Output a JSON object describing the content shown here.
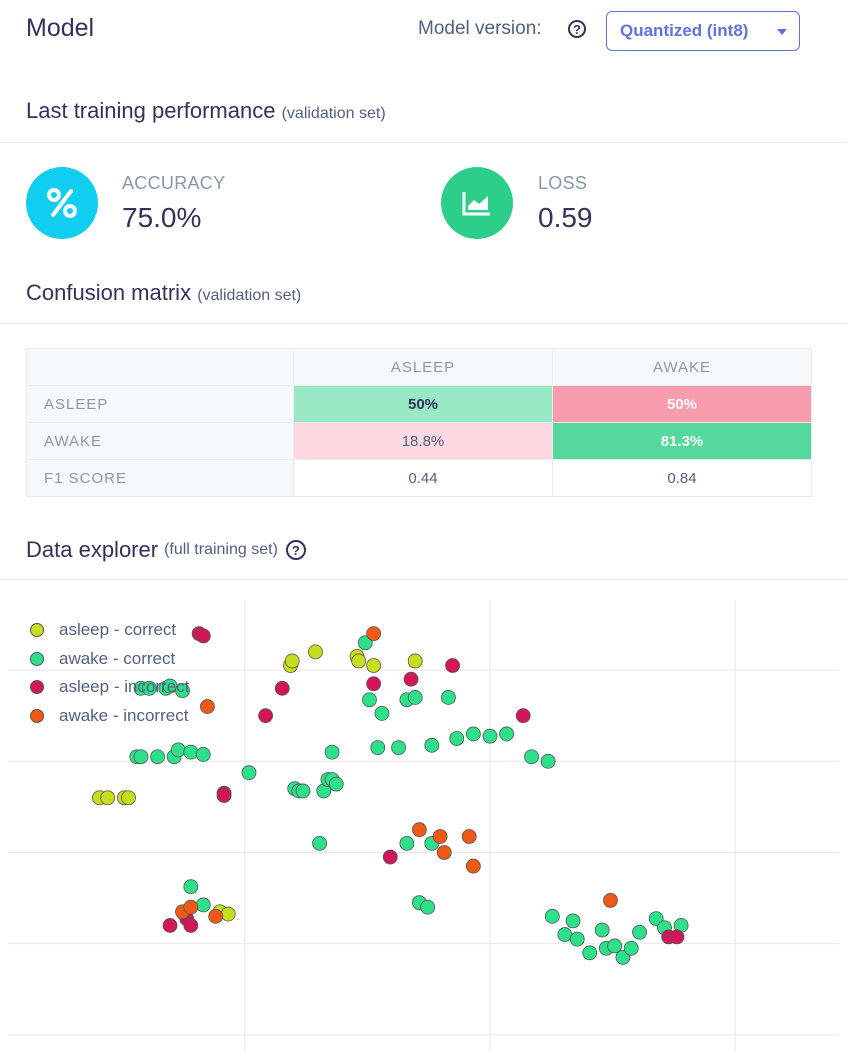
{
  "header": {
    "title": "Model",
    "version_label": "Model version:",
    "version_value": "Quantized (int8)"
  },
  "performance": {
    "title": "Last training performance",
    "subtitle": "(validation set)",
    "accuracy_label": "ACCURACY",
    "accuracy_value": "75.0%",
    "loss_label": "LOSS",
    "loss_value": "0.59",
    "accuracy_color": "#11cdef",
    "loss_color": "#2dce89"
  },
  "confusion": {
    "title": "Confusion matrix",
    "subtitle": "(validation set)",
    "columns": [
      "ASLEEP",
      "AWAKE"
    ],
    "rows": [
      {
        "label": "ASLEEP",
        "cells": [
          "50%",
          "50%"
        ]
      },
      {
        "label": "AWAKE",
        "cells": [
          "18.8%",
          "81.3%"
        ]
      },
      {
        "label": "F1 SCORE",
        "cells": [
          "0.44",
          "0.84"
        ]
      }
    ],
    "cell_colors": {
      "asleep_asleep": "#98e9c4",
      "asleep_awake": "#f99cae",
      "awake_asleep": "#fcd9e0",
      "awake_awake": "#55d89d"
    }
  },
  "explorer": {
    "title": "Data explorer",
    "subtitle": "(full training set)"
  },
  "chart_data": {
    "type": "scatter",
    "legend_position": "top-left",
    "grid": true,
    "xlim": [
      0,
      100
    ],
    "ylim": [
      0,
      100
    ],
    "series": [
      {
        "name": "asleep - correct",
        "color": "#c7de1e",
        "points": [
          [
            11,
            54
          ],
          [
            12,
            54
          ],
          [
            14,
            54
          ],
          [
            14.5,
            54
          ],
          [
            25.5,
            29
          ],
          [
            26.5,
            28.5
          ],
          [
            34,
            83
          ],
          [
            34.2,
            84
          ],
          [
            37,
            86
          ],
          [
            42,
            85
          ],
          [
            42.2,
            84
          ],
          [
            44,
            83
          ],
          [
            49,
            84
          ]
        ]
      },
      {
        "name": "awake - correct",
        "color": "#2ee08a",
        "points": [
          [
            16,
            78
          ],
          [
            17,
            78
          ],
          [
            19,
            78
          ],
          [
            19.5,
            78.5
          ],
          [
            21,
            77.5
          ],
          [
            15.5,
            63
          ],
          [
            16,
            63
          ],
          [
            18,
            63
          ],
          [
            20,
            63
          ],
          [
            20.5,
            64.5
          ],
          [
            22,
            64
          ],
          [
            23.5,
            63.5
          ],
          [
            29,
            59.5
          ],
          [
            34.5,
            56
          ],
          [
            35,
            55.5
          ],
          [
            35.5,
            55.5
          ],
          [
            38,
            55.5
          ],
          [
            38.5,
            58
          ],
          [
            39,
            58
          ],
          [
            39.5,
            57
          ],
          [
            39,
            64
          ],
          [
            37.5,
            44
          ],
          [
            22,
            34.5
          ],
          [
            23.5,
            30.5
          ],
          [
            43,
            88
          ],
          [
            43.5,
            75.5
          ],
          [
            45,
            72.5
          ],
          [
            44.5,
            65
          ],
          [
            47,
            65
          ],
          [
            48,
            75.5
          ],
          [
            49,
            76
          ],
          [
            51,
            65.5
          ],
          [
            48,
            44
          ],
          [
            51,
            44
          ],
          [
            49.5,
            31
          ],
          [
            50.5,
            30
          ],
          [
            53,
            76
          ],
          [
            54,
            67
          ],
          [
            56,
            68
          ],
          [
            58,
            67.5
          ],
          [
            60,
            68
          ],
          [
            63,
            63
          ],
          [
            65,
            62
          ],
          [
            65.5,
            28
          ],
          [
            67,
            24
          ],
          [
            68,
            27
          ],
          [
            68.5,
            23
          ],
          [
            70,
            20
          ],
          [
            71.5,
            25
          ],
          [
            72,
            21
          ],
          [
            73,
            21.5
          ],
          [
            74,
            19
          ],
          [
            75,
            21
          ],
          [
            76,
            24.5
          ],
          [
            78,
            27.5
          ],
          [
            79,
            25.5
          ],
          [
            81,
            26
          ]
        ]
      },
      {
        "name": "asleep - incorrect",
        "color": "#d1165a",
        "points": [
          [
            23,
            90
          ],
          [
            23.5,
            89.5
          ],
          [
            26,
            55
          ],
          [
            26,
            54.5
          ],
          [
            31,
            72
          ],
          [
            33,
            78
          ],
          [
            44,
            79
          ],
          [
            46,
            41
          ],
          [
            48.5,
            80
          ],
          [
            53.5,
            83
          ],
          [
            62,
            72
          ],
          [
            19.5,
            26
          ],
          [
            21.5,
            27.5
          ],
          [
            22,
            26
          ],
          [
            79.5,
            23.5
          ],
          [
            80.5,
            23.5
          ]
        ]
      },
      {
        "name": "awake - incorrect",
        "color": "#ec5a16",
        "points": [
          [
            24,
            74
          ],
          [
            21,
            29
          ],
          [
            22,
            30
          ],
          [
            25,
            28
          ],
          [
            44,
            90
          ],
          [
            49.5,
            47
          ],
          [
            52,
            45.5
          ],
          [
            55.5,
            45.5
          ],
          [
            52.5,
            42
          ],
          [
            56,
            39
          ],
          [
            72.5,
            31.5
          ]
        ]
      }
    ]
  }
}
